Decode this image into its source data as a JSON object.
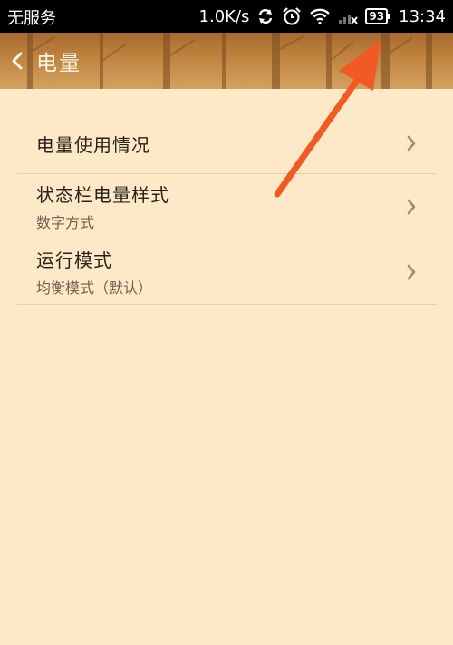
{
  "status_bar": {
    "carrier": "无服务",
    "network_speed": "1.0K/s",
    "battery_level": "93",
    "time": "13:34",
    "icons": [
      "sync-icon",
      "alarm-icon",
      "wifi-icon",
      "signal-icon",
      "battery-icon"
    ]
  },
  "header": {
    "title": "电量",
    "back_icon": "chevron-left-icon"
  },
  "settings": {
    "items": [
      {
        "title": "电量使用情况",
        "subtitle": ""
      },
      {
        "title": "状态栏电量样式",
        "subtitle": "数字方式"
      },
      {
        "title": "运行模式",
        "subtitle": "均衡模式（默认）"
      }
    ]
  },
  "colors": {
    "background": "#fde9c7",
    "header": "#c08440",
    "annotation_arrow": "#f15a24"
  }
}
